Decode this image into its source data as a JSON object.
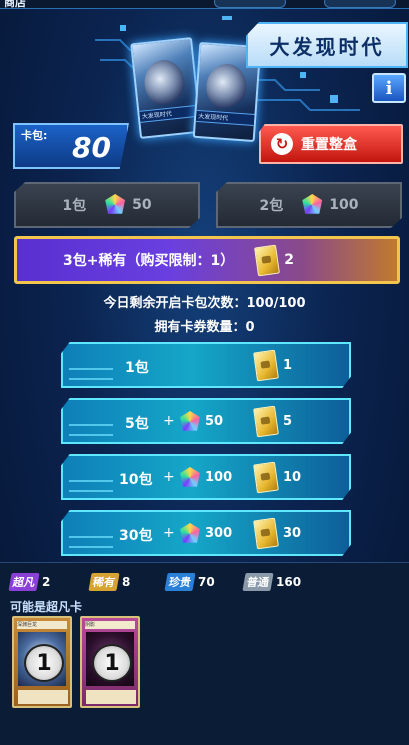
{
  "topbar": {
    "title": "商店"
  },
  "header": {
    "title": "大发现时代",
    "info_label": "i",
    "pack_art_label": "大发现时代"
  },
  "pack_counter": {
    "label": "卡包:",
    "value": "80"
  },
  "reset_button": {
    "label": "重置整盒"
  },
  "grey_buttons": [
    {
      "label": "1包",
      "cost": "50"
    },
    {
      "label": "2包",
      "cost": "100"
    }
  ],
  "featured": {
    "label": "3包+稀有（购买限制：1）",
    "tickets": "2"
  },
  "info": {
    "remaining": "今日剩余开启卡包次数：100/100",
    "tickets_owned": "拥有卡券数量：0"
  },
  "rows": [
    {
      "packs": "1包",
      "gems": "",
      "tickets": "1"
    },
    {
      "packs": "5包",
      "gems": "50",
      "tickets": "5"
    },
    {
      "packs": "10包",
      "gems": "100",
      "tickets": "10"
    },
    {
      "packs": "30包",
      "gems": "300",
      "tickets": "30"
    }
  ],
  "plus_sign": "+",
  "rarity": [
    {
      "tag": "超凡",
      "count": "2",
      "color": "#8a3fd6"
    },
    {
      "tag": "稀有",
      "count": "8",
      "color": "#d6a232"
    },
    {
      "tag": "珍贵",
      "count": "70",
      "color": "#2a7fd6"
    },
    {
      "tag": "普通",
      "count": "160",
      "color": "#8a9aaa"
    }
  ],
  "possible_label": "可能是超凡卡",
  "cards": [
    {
      "badge": "1",
      "name": "深渊巨龙",
      "color": "#c88a3a"
    },
    {
      "badge": "1",
      "name": "阴影",
      "color": "#b84a9a"
    }
  ]
}
